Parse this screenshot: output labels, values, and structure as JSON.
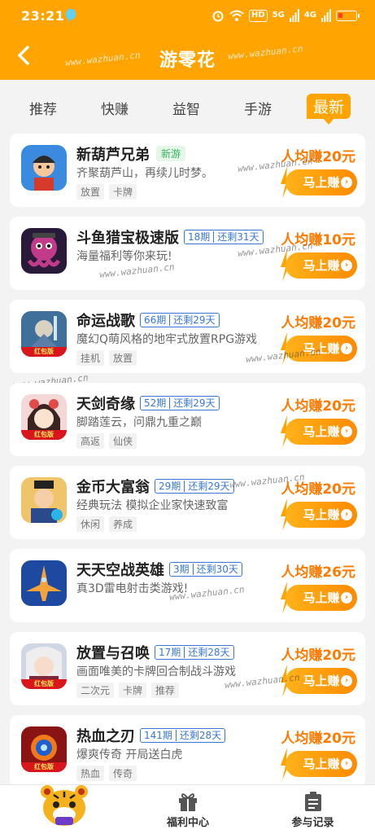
{
  "status": {
    "time": "23:21",
    "hd": "HD",
    "sig1": "5G",
    "sig2": "4G"
  },
  "header": {
    "title": "游零花",
    "watermark": "www.wazhuan.cn"
  },
  "tabs": [
    {
      "label": "推荐"
    },
    {
      "label": "快赚"
    },
    {
      "label": "益智"
    },
    {
      "label": "手游"
    },
    {
      "label": "最新"
    }
  ],
  "colors": {
    "brand": "#ffa400",
    "reward": "#ff7a00",
    "period": "#3a78d6",
    "new": "#35b45a"
  },
  "games": [
    {
      "name": "新葫芦兄弟",
      "badge": "新游",
      "desc": "齐聚葫芦山，再续儿时梦。",
      "tags": [
        "放置",
        "卡牌"
      ],
      "reward": "人均赚20元",
      "button": "马上赚",
      "icon": "calabash-brother-icon"
    },
    {
      "name": "斗鱼猎宝极速版",
      "period": "18期",
      "remaining": "还剩31天",
      "desc": "海量福利等你来玩!",
      "tags": [],
      "reward": "人均赚10元",
      "button": "马上赚",
      "icon": "octopus-icon"
    },
    {
      "name": "命运战歌",
      "period": "66期",
      "remaining": "还剩29天",
      "desc": "魔幻Q萌风格的地牢式放置RPG游戏",
      "tags": [
        "挂机",
        "放置"
      ],
      "reward": "人均赚20元",
      "button": "马上赚",
      "icon": "knight-icon",
      "redpkt": "红包版"
    },
    {
      "name": "天剑奇缘",
      "period": "52期",
      "remaining": "还剩29天",
      "desc": "脚踏莲云，问鼎九重之巅",
      "tags": [
        "高返",
        "仙侠"
      ],
      "reward": "人均赚20元",
      "button": "马上赚",
      "icon": "anime-girl-icon",
      "redpkt": "红包版"
    },
    {
      "name": "金币大富翁",
      "period": "29期",
      "remaining": "还剩29天",
      "desc": "经典玩法 模拟企业家快速致富",
      "tags": [
        "休闲",
        "养成"
      ],
      "reward": "人均赚20元",
      "button": "马上赚",
      "icon": "tycoon-icon"
    },
    {
      "name": "天天空战英雄",
      "period": "3期",
      "remaining": "还剩30天",
      "desc": "真3D雷电射击类游戏!",
      "tags": [],
      "reward": "人均赚26元",
      "button": "马上赚",
      "icon": "fighter-jet-icon"
    },
    {
      "name": "放置与召唤",
      "period": "17期",
      "remaining": "还剩28天",
      "desc": "画面唯美的卡牌回合制战斗游戏",
      "tags": [
        "二次元",
        "卡牌",
        "推荐"
      ],
      "reward": "人均赚20元",
      "button": "马上赚",
      "icon": "summoner-icon",
      "redpkt": "红包版"
    },
    {
      "name": "热血之刃",
      "period": "141期",
      "remaining": "还剩28天",
      "desc": "爆爽传奇 开局送白虎",
      "tags": [
        "热血",
        "传奇"
      ],
      "reward": "人均赚20元",
      "button": "马上赚",
      "icon": "fire-orb-icon",
      "redpkt": "红包版"
    }
  ],
  "bottom_nav": [
    {
      "label": "",
      "icon": "tiger-mascot-icon"
    },
    {
      "label": "福利中心",
      "icon": "gift-icon"
    },
    {
      "label": "参与记录",
      "icon": "clipboard-icon"
    }
  ]
}
